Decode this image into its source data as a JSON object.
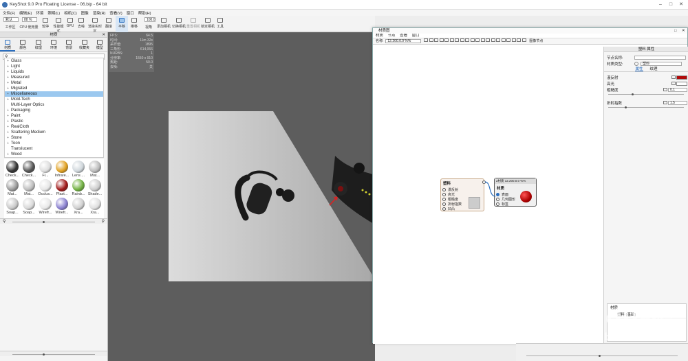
{
  "window": {
    "title": "KeyShot 9.0 Pro Floating License - 06.bip - 64 bit"
  },
  "menu": [
    "文件(F)",
    "编辑(E)",
    "环境",
    "照明(L)",
    "相机(C)",
    "图像",
    "渲染(R)",
    "查看(V)",
    "窗口",
    "帮助(H)"
  ],
  "toolbar": {
    "workspace_select": "默认",
    "cpu_select": "88 %",
    "zoom_value": "100.0",
    "items": [
      {
        "label": "工作区",
        "icon": "workspace-icon"
      },
      {
        "label": "CPU 使用量",
        "icon": "cpu-icon"
      },
      {
        "label": "暂停",
        "icon": "pause-icon"
      },
      {
        "label": "性能模式",
        "icon": "performance-icon"
      },
      {
        "label": "GPU",
        "icon": "gpu-icon"
      },
      {
        "label": "去噪",
        "icon": "denoise-icon"
      },
      {
        "label": "渲染实时区",
        "icon": "render-region-icon"
      },
      {
        "label": "翻滚",
        "icon": "tumble-icon"
      },
      {
        "label": "平移",
        "icon": "pan-icon"
      },
      {
        "label": "推移",
        "icon": "dolly-icon"
      },
      {
        "label": "视角",
        "icon": "fov-icon"
      },
      {
        "label": "添加相机",
        "icon": "add-camera-icon"
      },
      {
        "label": "切换相机",
        "icon": "switch-camera-icon"
      },
      {
        "label": "重置相机",
        "icon": "reset-camera-icon"
      },
      {
        "label": "锁定相机",
        "icon": "lock-camera-icon"
      },
      {
        "label": "工具",
        "icon": "tools-icon"
      }
    ]
  },
  "library": {
    "header": "材质",
    "tabs": [
      {
        "label": "材质",
        "icon": "material-icon"
      },
      {
        "label": "颜色",
        "icon": "color-icon"
      },
      {
        "label": "纹理",
        "icon": "texture-icon"
      },
      {
        "label": "环境",
        "icon": "environment-icon"
      },
      {
        "label": "背景",
        "icon": "background-icon"
      },
      {
        "label": "收藏夹",
        "icon": "favorites-icon"
      },
      {
        "label": "模型",
        "icon": "model-icon"
      }
    ],
    "tree": [
      "Glass",
      "Light",
      "Liquids",
      "Measured",
      "Metal",
      "Migrated",
      "Miscellaneous",
      "Mold-Tech",
      "Multi-Layer Optics",
      "Packaging",
      "Paint",
      "Plastic",
      "RealCloth",
      "Scattering Medium",
      "Stone",
      "Toon",
      "Translucent",
      "Wood"
    ],
    "selected": "Miscellaneous",
    "thumbnails": [
      {
        "label": "Check...",
        "color": "#333333"
      },
      {
        "label": "Check...",
        "color": "#555555"
      },
      {
        "label": "Fl...",
        "color": "#dddddd"
      },
      {
        "label": "Infrare...",
        "color": "#e0a020"
      },
      {
        "label": "Lens ...",
        "color": "#cfd6db"
      },
      {
        "label": "Mat...",
        "color": "#bbbbbb"
      },
      {
        "label": "Mat...",
        "color": "#9a9a9a"
      },
      {
        "label": "Mat...",
        "color": "#bdbdbd"
      },
      {
        "label": "Occlus...",
        "color": "#e6e6e6"
      },
      {
        "label": "Plast...",
        "color": "#a01818"
      },
      {
        "label": "Rainb...",
        "color": "#70b040"
      },
      {
        "label": "Shade...",
        "color": "#cccccc"
      },
      {
        "label": "Soap...",
        "color": "#c8c8c8"
      },
      {
        "label": "Soap...",
        "color": "#d8d8d8"
      },
      {
        "label": "Wirefr...",
        "color": "#e8e8e8"
      },
      {
        "label": "Wirefr...",
        "color": "#8a80d0"
      },
      {
        "label": "Xra...",
        "color": "#cfcfcf"
      },
      {
        "label": "Xra...",
        "color": "#dfdfdf"
      }
    ]
  },
  "hud": [
    [
      "FPS:",
      "64.5"
    ],
    [
      "时间:",
      "11m 32s"
    ],
    [
      "采样值:",
      "1895"
    ],
    [
      "三角形:",
      "614,066"
    ],
    [
      "NURBS:",
      "1"
    ],
    [
      "分辨率:",
      "1550 x 910"
    ],
    [
      "焦距:",
      "50.0"
    ],
    [
      "去噪:",
      "关"
    ]
  ],
  "material_window": {
    "title": "材质图",
    "menu": [
      "材质",
      "节点",
      "查看",
      "窗口"
    ],
    "name_label": "名称:",
    "name_value": "12.200.0.0 %%",
    "toolbar_right": "图像节点",
    "node_plastic": {
      "title": "塑料",
      "ports": [
        "漫反射",
        "高光",
        "粗糙度",
        "折射指数",
        "凹凸"
      ]
    },
    "node_material": {
      "header": "2材质 12.200.0.0 %%",
      "title": "材质",
      "ports": [
        "表面",
        "几何图形",
        "标签"
      ]
    }
  },
  "properties": {
    "title": "塑料 属性",
    "node_name_label": "节点名称:",
    "node_name_value": "",
    "material_type_label": "材质类型:",
    "material_type_value": "塑料",
    "tabs": [
      "属性",
      "纹理"
    ],
    "rows": [
      {
        "label": "漫反射",
        "kind": "color",
        "value": "#b10a0a"
      },
      {
        "label": "高光",
        "kind": "color",
        "value": "#ffffff"
      },
      {
        "label": "粗糙度",
        "kind": "number",
        "value": "0.1"
      },
      {
        "label": "折射指数",
        "kind": "number",
        "value": "1.5"
      }
    ],
    "scene_tree": {
      "root": "材质",
      "child": "塑料 (基础)"
    }
  }
}
